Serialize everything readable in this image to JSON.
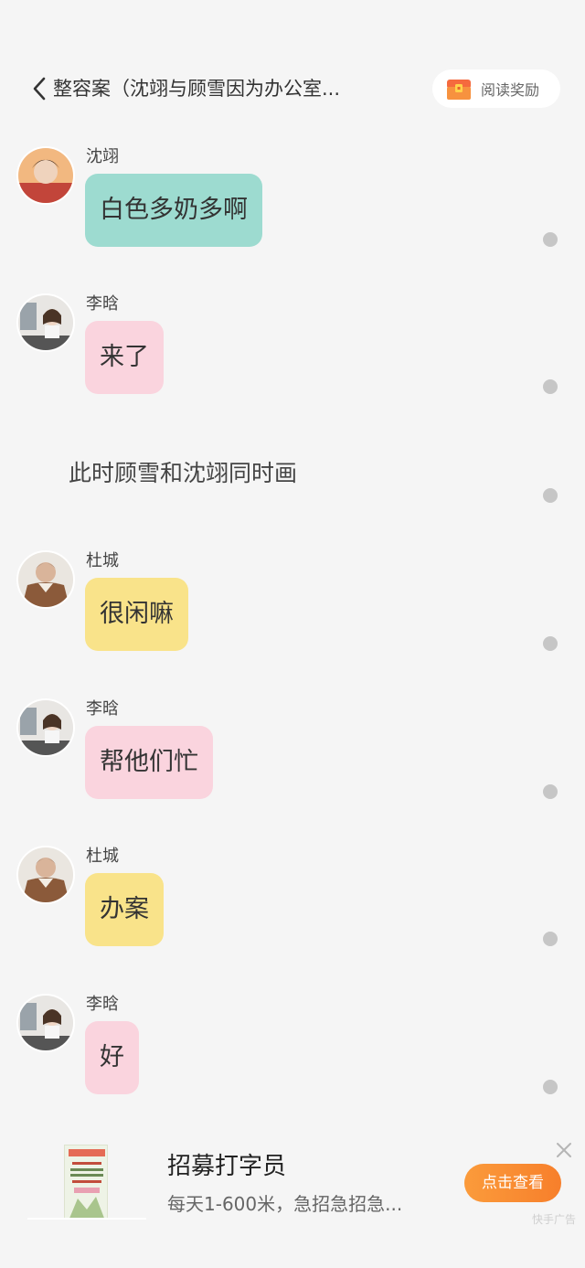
{
  "header": {
    "title": "整容案（沈翊与顾雪因为办公室...",
    "reward_label": "阅读奖励",
    "back_icon": "chevron-left-icon",
    "reward_icon": "treasure-chest-icon"
  },
  "messages": [
    {
      "speaker": "沈翊",
      "text": "白色多奶多啊",
      "bubble_color": "#9ddbd0"
    },
    {
      "speaker": "李晗",
      "text": "来了",
      "bubble_color": "#fad4de"
    },
    {
      "speaker": "杜城",
      "text": "很闲嘛",
      "bubble_color": "#f9e38a"
    },
    {
      "speaker": "李晗",
      "text": "帮他们忙",
      "bubble_color": "#fad4de"
    },
    {
      "speaker": "杜城",
      "text": "办案",
      "bubble_color": "#f9e38a"
    },
    {
      "speaker": "李晗",
      "text": "好",
      "bubble_color": "#fad4de"
    }
  ],
  "narration": "此时顾雪和沈翊同时画",
  "ad": {
    "title": "招募打字员",
    "subtitle": "每天1-600米，急招急招急...",
    "cta_label": "点击查看",
    "tag": "快手广告",
    "close_icon": "close-icon"
  },
  "colors": {
    "background": "#f5f5f5",
    "accent_orange": "#f77f2b",
    "dot_gray": "#c6c6c6"
  }
}
